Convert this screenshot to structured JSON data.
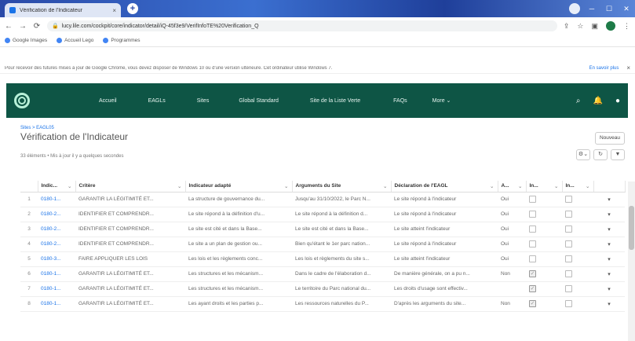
{
  "browser": {
    "tab_title": "Vérification de l'Indicateur",
    "tab_close": "×",
    "new_tab": "+",
    "window_min": "─",
    "window_max": "☐",
    "window_close": "✕",
    "url": "lucy.lile.com/cockpit/core/indicator/detail/iQ-45f3e9/VerifInfoTE%20Verification_Q",
    "bookmarks": [
      "Google Images",
      "Accueil Lego",
      "Programmes"
    ],
    "info_message": "Pour recevoir des futures mises à jour de Google Chrome, vous devez disposer de Windows 10 ou d'une version ultérieure. Cet ordinateur utilise Windows 7.",
    "info_more": "En savoir plus",
    "info_close": "×"
  },
  "appbar": {
    "nav": [
      "Accueil",
      "EAGLs",
      "Sites",
      "Global Standard",
      "Site de la Liste Verte",
      "FAQs",
      "More ⌄"
    ],
    "icons": [
      "search-icon",
      "notifications-icon",
      "user-icon"
    ]
  },
  "page": {
    "breadcrumb": "Sites > EAGL05",
    "title": "Vérification de l'Indicateur",
    "meta": "33 éléments • Mis à jour il y a quelques secondes",
    "new_button": "Nouveau",
    "tools": [
      "⚙⌄",
      "↻",
      "▼"
    ]
  },
  "table": {
    "headers": [
      "",
      "Indic...",
      "Critère",
      "Indicateur adapté",
      "Arguments du Site",
      "Déclaration de l'EAGL",
      "A...",
      "In...",
      "In...",
      ""
    ],
    "rows": [
      {
        "n": "1",
        "id": "0180-1...",
        "critere": "GARANTIR LA LÉGITIMITÉ ET...",
        "indic": "La structure de gouvernance du...",
        "arg": "Jusqu'au 31/10/2022, le Parc N...",
        "decl": "Le site répond à l'indicateur",
        "a": "Oui",
        "i1": false,
        "i2": false
      },
      {
        "n": "2",
        "id": "0180-2...",
        "critere": "IDENTIFIER ET COMPRENDR...",
        "indic": "Le site répond à la définition d'u...",
        "arg": "Le site répond à la définition d...",
        "decl": "Le site répond à l'indicateur",
        "a": "Oui",
        "i1": false,
        "i2": false
      },
      {
        "n": "3",
        "id": "0180-2...",
        "critere": "IDENTIFIER ET COMPRENDR...",
        "indic": "Le site est cité et dans la Base...",
        "arg": "Le site est cité et dans la Base...",
        "decl": "Le site atteint l'indicateur",
        "a": "Oui",
        "i1": false,
        "i2": false
      },
      {
        "n": "4",
        "id": "0180-2...",
        "critere": "IDENTIFIER ET COMPRENDR...",
        "indic": "Le site a un plan de gestion ou...",
        "arg": "Bien qu'étant le 1er parc nation...",
        "decl": "Le site répond à l'indicateur",
        "a": "Oui",
        "i1": false,
        "i2": false
      },
      {
        "n": "5",
        "id": "0180-3...",
        "critere": "FAIRE APPLIQUER LES LOIS",
        "indic": "Les lois et les règlements conc...",
        "arg": "Les lois et règlements du site s...",
        "decl": "Le site atteint l'indicateur",
        "a": "Oui",
        "i1": false,
        "i2": false
      },
      {
        "n": "6",
        "id": "0180-1...",
        "critere": "GARANTIR LA LÉGITIMITÉ ET...",
        "indic": "Les structures et les mécanism...",
        "arg": "Dans le cadre de l'élaboration d...",
        "decl": "De manière générale, on a pu n...",
        "a": "Non",
        "i1": true,
        "i2": false
      },
      {
        "n": "7",
        "id": "0180-1...",
        "critere": "GARANTIR LA LÉGITIMITÉ ET...",
        "indic": "Les structures et les mécanism...",
        "arg": "Le territoire du Parc national du...",
        "decl": "Les droits d'usage sont effectiv...",
        "a": "",
        "i1": true,
        "i2": false
      },
      {
        "n": "8",
        "id": "0180-1...",
        "critere": "GARANTIR LA LÉGITIMITÉ ET...",
        "indic": "Les ayant droits et les parties p...",
        "arg": "Les ressources naturelles du P...",
        "decl": "D'après les arguments du site...",
        "a": "Non",
        "i1": true,
        "i2": false
      }
    ],
    "row_action": "▾"
  }
}
